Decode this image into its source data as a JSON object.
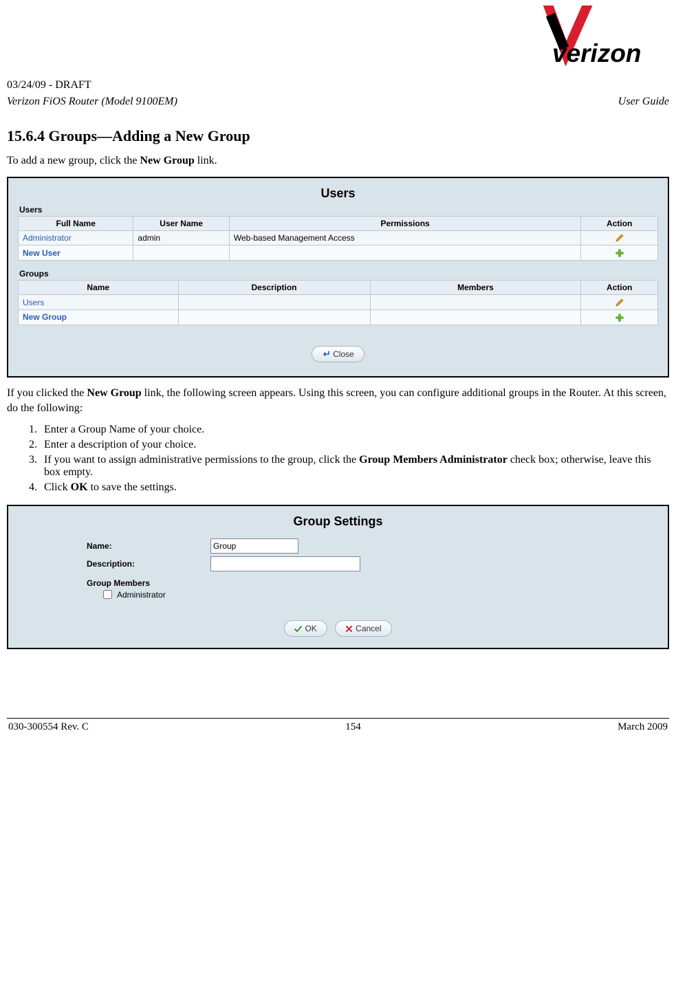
{
  "header": {
    "draft": "03/24/09 - DRAFT",
    "model": "Verizon FiOS Router (Model 9100EM)",
    "doc_type": "User Guide"
  },
  "section": {
    "heading": "15.6.4 Groups—Adding a New Group",
    "intro_pre": "To add a new group, click the ",
    "intro_bold": "New Group",
    "intro_post": " link.",
    "after_pre": "If you clicked the ",
    "after_bold": "New Group",
    "after_post": " link, the following screen appears. Using this screen, you can configure additional groups in the Router. At this screen, do the following:",
    "steps": {
      "s1": "Enter a Group Name of your choice.",
      "s2": "Enter a description of your choice.",
      "s3_pre": "If you want to assign administrative permissions to the group, click the ",
      "s3_bold": "Group Members Administrator",
      "s3_post": " check box; otherwise, leave this box empty.",
      "s4_pre": "Click ",
      "s4_bold": "OK",
      "s4_post": " to save the settings."
    }
  },
  "screenshot1": {
    "title": "Users",
    "users_label": "Users",
    "users_headers": {
      "full_name": "Full Name",
      "user_name": "User Name",
      "permissions": "Permissions",
      "action": "Action"
    },
    "users_rows": [
      {
        "full_name": "Administrator",
        "user_name": "admin",
        "permissions": "Web-based Management Access"
      },
      {
        "full_name": "New User",
        "user_name": "",
        "permissions": ""
      }
    ],
    "groups_label": "Groups",
    "groups_headers": {
      "name": "Name",
      "description": "Description",
      "members": "Members",
      "action": "Action"
    },
    "groups_rows": [
      {
        "name": "Users",
        "description": "",
        "members": ""
      },
      {
        "name": "New Group",
        "description": "",
        "members": ""
      }
    ],
    "close_label": "Close"
  },
  "screenshot2": {
    "title": "Group Settings",
    "name_label": "Name:",
    "name_value": "Group",
    "description_label": "Description:",
    "description_value": "",
    "members_heading": "Group Members",
    "admin_label": "Administrator",
    "ok_label": "OK",
    "cancel_label": "Cancel"
  },
  "footer": {
    "left": "030-300554 Rev. C",
    "center": "154",
    "right": "March 2009"
  }
}
